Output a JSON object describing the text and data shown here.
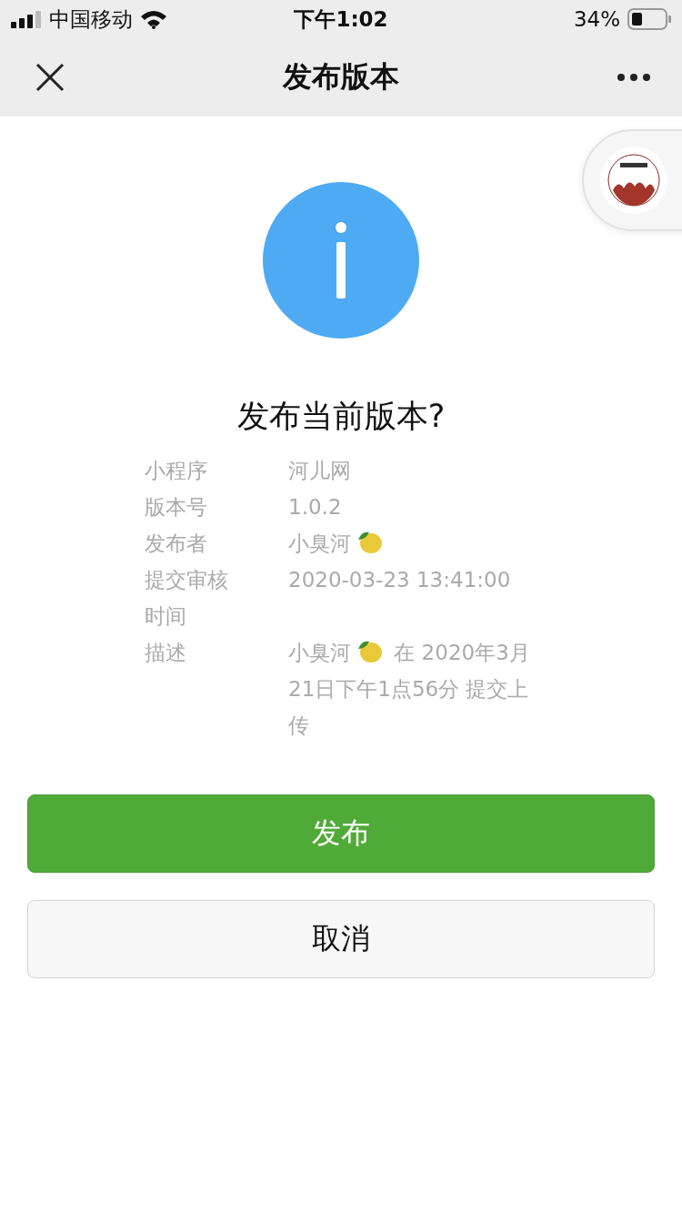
{
  "status_bar": {
    "carrier": "中国移动",
    "time": "下午1:02",
    "battery": "34%"
  },
  "nav": {
    "title": "发布版本"
  },
  "dialog": {
    "title": "发布当前版本?",
    "rows": [
      {
        "kind": "text",
        "label": "小程序",
        "value": "河儿网"
      },
      {
        "kind": "text",
        "label": "版本号",
        "value": "1.0.2"
      },
      {
        "kind": "user",
        "label": "发布者",
        "value": "小臭河"
      },
      {
        "kind": "text",
        "label": "提交审核时间",
        "value": "2020-03-23 13:41:00"
      },
      {
        "kind": "user",
        "label": "描述",
        "value": "小臭河",
        "after": "在 2020年3月21日下午1点56分 提交上传"
      }
    ],
    "buttons": [
      {
        "kind": "primary",
        "label": "发布"
      },
      {
        "kind": "default",
        "label": "取消"
      }
    ]
  }
}
